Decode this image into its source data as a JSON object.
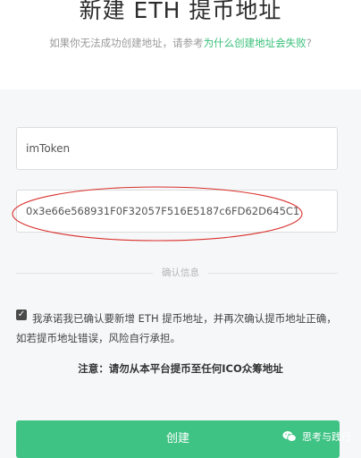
{
  "header": {
    "title": "新建 ETH 提币地址",
    "subtitle_prefix": "如果你无法成功创建地址，请参考",
    "subtitle_link": "为什么创建地址会失败",
    "subtitle_suffix": "?"
  },
  "form": {
    "name_value": "imToken",
    "address_value": "0x3e66e568931F0F32057F516E5187c6FD62D645C1",
    "divider_label": "确认信息",
    "confirm_text": "我承诺我已确认要新增 ETH 提币地址，并再次确认提币地址正确，如若提币地址错误，风险自行承担。",
    "confirm_checked": true,
    "notice": "注意：请勿从本平台提币至任何ICO众筹地址",
    "create_label": "创建"
  },
  "watermark": {
    "text": "思考与践行",
    "icon": "wechat-icon"
  },
  "colors": {
    "accent": "#3fc384",
    "link": "#39c07a",
    "annotation": "#d9302c"
  }
}
